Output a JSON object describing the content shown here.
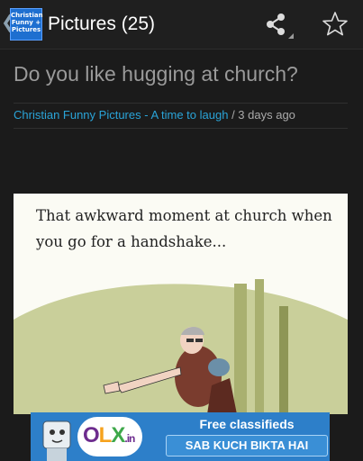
{
  "action_bar": {
    "title": "Pictures (25)",
    "app_icon_text": [
      "Christian",
      "Funny +",
      "Pictures"
    ],
    "icons": [
      "back-chevron-icon",
      "share-icon",
      "star-icon"
    ]
  },
  "post": {
    "title": "Do you like hugging at church?",
    "source": "Christian Funny Pictures - A time to laugh",
    "separator": " / ",
    "age": "3 days ago"
  },
  "comic": {
    "caption": "That awkward moment at church when you go for a handshake..."
  },
  "ad": {
    "brand_o": "O",
    "brand_l": "L",
    "brand_x": "X",
    "brand_suffix": ".in",
    "headline": "Free classifieds",
    "tagline": "SAB KUCH BIKTA HAI"
  },
  "colors": {
    "background": "#1b1b1b",
    "link": "#2aa4d8",
    "ad_blue": "#2d7fc9"
  }
}
